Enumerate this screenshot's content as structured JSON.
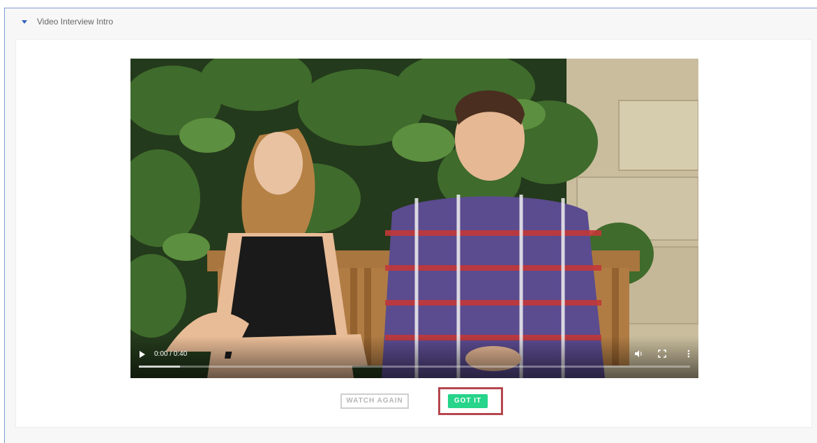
{
  "section": {
    "title": "Video Interview Intro",
    "caret_icon": "caret-down-icon",
    "accent_color": "#2f5fb8"
  },
  "video": {
    "current_time": "0:00 / 0:40",
    "progress_fraction": 0.0,
    "buffered_fraction": 0.075,
    "icons": [
      "play-icon",
      "volume-icon",
      "fullscreen-icon",
      "more-vertical-icon"
    ]
  },
  "actions": {
    "watch_again_label": "WATCH AGAIN",
    "got_it_label": "GOT IT",
    "got_it_color": "#26d48a",
    "highlight_color": "#b5474e"
  }
}
